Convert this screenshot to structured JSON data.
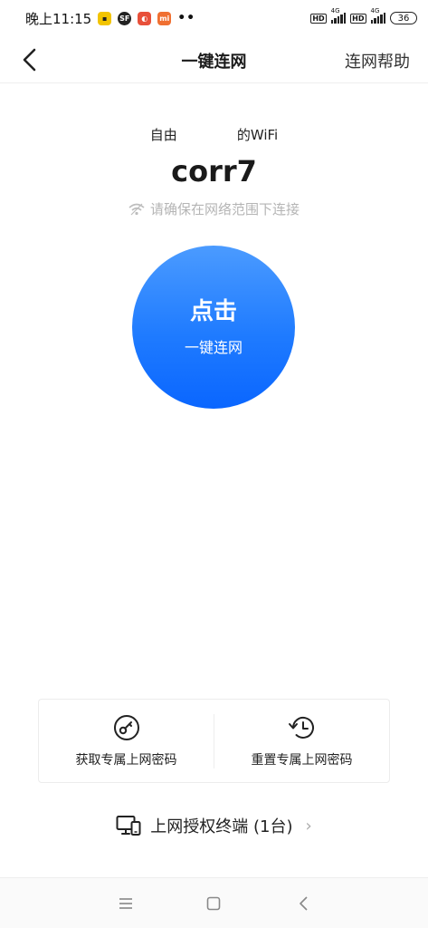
{
  "status_bar": {
    "time": "晚上11:15",
    "app_icons": [
      "yellow-app-icon",
      "sf-app-icon",
      "red-app-icon",
      "mi-app-icon"
    ],
    "sf_label": "SF",
    "mi_label": "mi",
    "more_dots": "••",
    "hd1": "HD",
    "hd2": "HD",
    "net1": "4G",
    "net2": "4G",
    "battery": "36"
  },
  "nav": {
    "title": "一键连网",
    "help": "连网帮助"
  },
  "wifi": {
    "prefix_start": "自由",
    "prefix_end": "的WiFi",
    "ssid": "corr7",
    "hint": "请确保在网络范围下连接"
  },
  "connect": {
    "main": "点击",
    "sub": "一键连网"
  },
  "options": [
    {
      "label": "获取专属上网密码",
      "icon": "key-icon"
    },
    {
      "label": "重置专属上网密码",
      "icon": "history-reset-icon"
    }
  ],
  "terminals": {
    "label": "上网授权终端 (1台)",
    "icon": "devices-icon"
  },
  "colors": {
    "accent": "#1f7bff",
    "hint": "#b5b5b5"
  }
}
